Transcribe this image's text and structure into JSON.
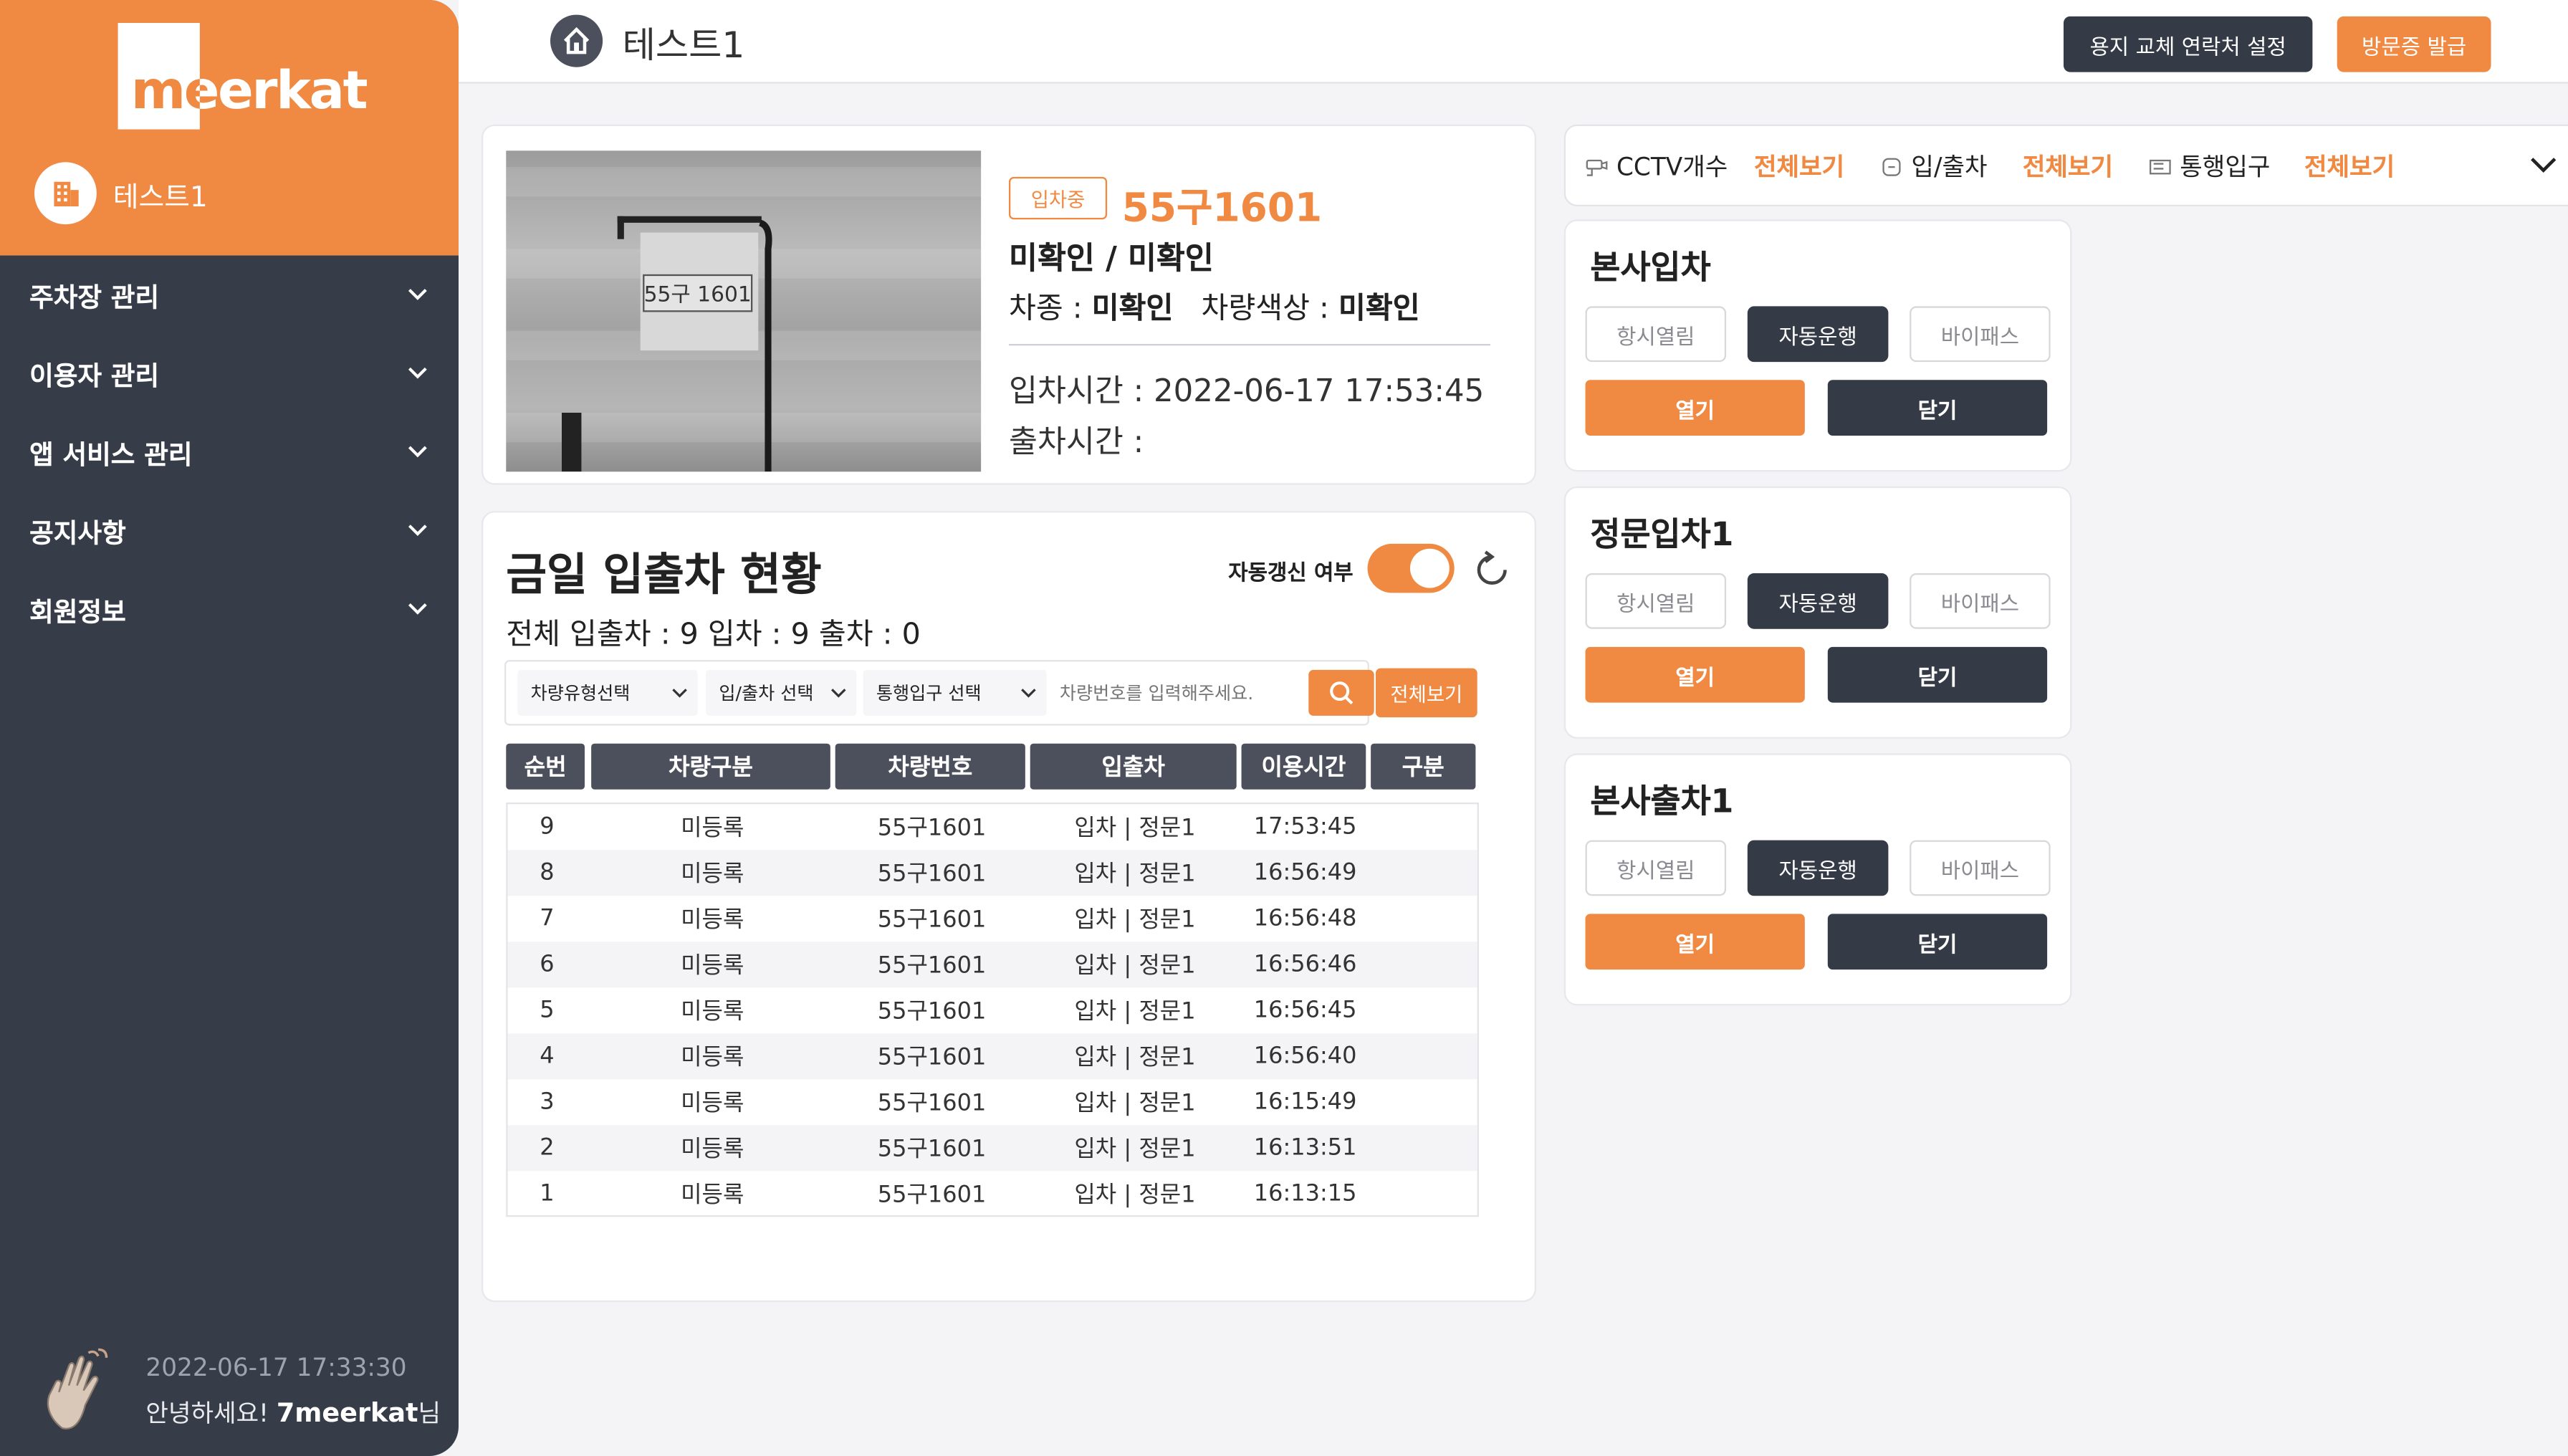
{
  "brand": {
    "name": "meerkat",
    "accent": "#f08a42",
    "dark": "#363c48"
  },
  "sidebar": {
    "site_name": "테스트1",
    "items": [
      {
        "label": "주차장 관리"
      },
      {
        "label": "이용자 관리"
      },
      {
        "label": "앱 서비스 관리"
      },
      {
        "label": "공지사항"
      },
      {
        "label": "회원정보"
      }
    ],
    "datetime": "2022-06-17 17:33:30",
    "greeting_prefix": "안녕하세요! ",
    "user": "7meerkat",
    "greeting_suffix": "님"
  },
  "header": {
    "title": "테스트1",
    "contact_button": "용지 교체 연락처 설정",
    "visitor_button": "방문증 발급"
  },
  "vehicle": {
    "status_badge": "입차중",
    "plate": "55구1601",
    "owner": "미확인 / 미확인",
    "type_label": "차종 : ",
    "type_value": "미확인",
    "color_label": "차량색상 : ",
    "color_value": "미확인",
    "entry_time": "입차시간 : 2022-06-17 17:53:45",
    "exit_time": "출차시간 :",
    "photo_plate_text": "55구 1601"
  },
  "today": {
    "title": "금일 입출차 현황",
    "auto_refresh_label": "자동갱신 여부",
    "auto_refresh_on": true,
    "counts": "전체 입출차 : 9   입차 : 9   출차 : 0",
    "filters": {
      "vehicle_type": "차량유형선택",
      "in_out": "입/출차 선택",
      "gate": "통행입구 선택",
      "search_placeholder": "차량번호를 입력해주세요.",
      "all_button": "전체보기"
    },
    "columns": [
      "순번",
      "차량구분",
      "차량번호",
      "입출차",
      "이용시간",
      "구분"
    ],
    "rows": [
      {
        "no": "9",
        "kind": "미등록",
        "plate": "55구1601",
        "inout": "입차 | 정문1",
        "time": "17:53:45",
        "div": ""
      },
      {
        "no": "8",
        "kind": "미등록",
        "plate": "55구1601",
        "inout": "입차 | 정문1",
        "time": "16:56:49",
        "div": ""
      },
      {
        "no": "7",
        "kind": "미등록",
        "plate": "55구1601",
        "inout": "입차 | 정문1",
        "time": "16:56:48",
        "div": ""
      },
      {
        "no": "6",
        "kind": "미등록",
        "plate": "55구1601",
        "inout": "입차 | 정문1",
        "time": "16:56:46",
        "div": ""
      },
      {
        "no": "5",
        "kind": "미등록",
        "plate": "55구1601",
        "inout": "입차 | 정문1",
        "time": "16:56:45",
        "div": ""
      },
      {
        "no": "4",
        "kind": "미등록",
        "plate": "55구1601",
        "inout": "입차 | 정문1",
        "time": "16:56:40",
        "div": ""
      },
      {
        "no": "3",
        "kind": "미등록",
        "plate": "55구1601",
        "inout": "입차 | 정문1",
        "time": "16:15:49",
        "div": ""
      },
      {
        "no": "2",
        "kind": "미등록",
        "plate": "55구1601",
        "inout": "입차 | 정문1",
        "time": "16:13:51",
        "div": ""
      },
      {
        "no": "1",
        "kind": "미등록",
        "plate": "55구1601",
        "inout": "입차 | 정문1",
        "time": "16:13:15",
        "div": ""
      }
    ]
  },
  "cctv_bar": {
    "cctv_label": "CCTV개수",
    "inout_label": "입/출차",
    "gate_label": "통행입구",
    "view_all": "전체보기"
  },
  "gates": [
    {
      "name": "본사입차",
      "mode_always": "항시열림",
      "mode_auto": "자동운행",
      "mode_bypass": "바이패스",
      "open": "열기",
      "close": "닫기",
      "active_mode": "auto"
    },
    {
      "name": "정문입차1",
      "mode_always": "항시열림",
      "mode_auto": "자동운행",
      "mode_bypass": "바이패스",
      "open": "열기",
      "close": "닫기",
      "active_mode": "auto"
    },
    {
      "name": "본사출차1",
      "mode_always": "항시열림",
      "mode_auto": "자동운행",
      "mode_bypass": "바이패스",
      "open": "열기",
      "close": "닫기",
      "active_mode": "auto"
    }
  ]
}
